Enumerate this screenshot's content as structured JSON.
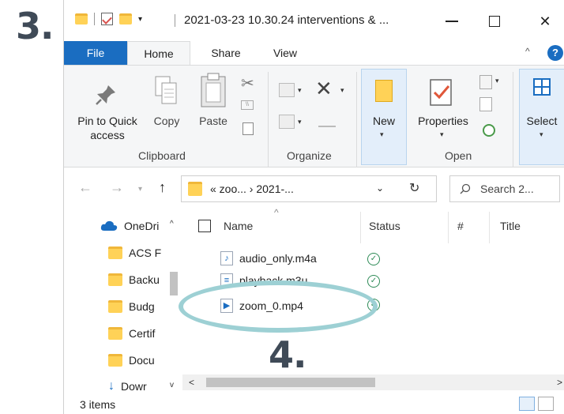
{
  "annotations": {
    "step_three": "3.",
    "step_four": "4."
  },
  "window": {
    "title": "2021-03-23 10.30.24 interventions & ...",
    "controls": {
      "minimize_icon": "minimize-icon",
      "maximize_icon": "maximize-icon",
      "close_icon": "close-icon",
      "close_glyph": "✕"
    }
  },
  "ribbon": {
    "tabs": [
      "File",
      "Home",
      "Share",
      "View"
    ],
    "active_tab": "Home",
    "clipboard": {
      "pin_label": "Pin to Quick access",
      "pin_line1": "Pin to Quick",
      "pin_line2": "access",
      "copy": "Copy",
      "paste": "Paste",
      "group": "Clipboard"
    },
    "organize": {
      "group": "Organize"
    },
    "open": {
      "new": "New",
      "properties": "Properties",
      "group": "Open"
    },
    "select": {
      "label": "Select"
    }
  },
  "navigation": {
    "address_path": "« zoo...  ›  2021-...",
    "search_placeholder": "Search 2..."
  },
  "nav_pane": {
    "items": [
      {
        "label": "OneDri",
        "icon": "cloud-icon"
      },
      {
        "label": "ACS F",
        "icon": "folder-icon"
      },
      {
        "label": "Backu",
        "icon": "folder-icon"
      },
      {
        "label": "Budg",
        "icon": "folder-icon"
      },
      {
        "label": "Certif",
        "icon": "folder-icon"
      },
      {
        "label": "Docu",
        "icon": "folder-icon"
      },
      {
        "label": "Dowr",
        "icon": "download-icon"
      }
    ]
  },
  "file_list": {
    "columns": [
      "Name",
      "Status",
      "#",
      "Title"
    ],
    "files": [
      {
        "name": "audio_only.m4a",
        "icon": "audio-file-icon",
        "status": "synced"
      },
      {
        "name": "playback.m3u",
        "icon": "playlist-file-icon",
        "status": "synced"
      },
      {
        "name": "zoom_0.mp4",
        "icon": "video-file-icon",
        "status": "synced"
      }
    ]
  },
  "status_bar": {
    "item_count": "3 items"
  },
  "colors": {
    "accent": "#1a6dc1",
    "folder": "#ffd257",
    "highlight": "#9dd0d4",
    "annotation": "#3f4a57"
  }
}
